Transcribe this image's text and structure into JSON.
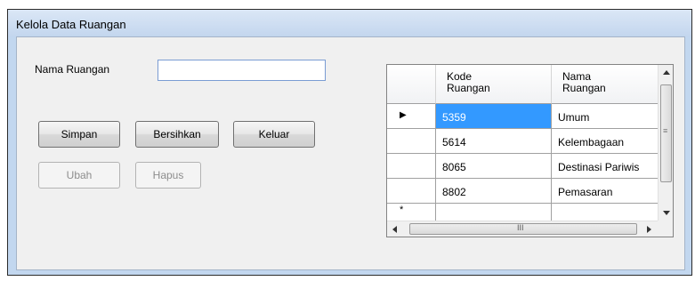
{
  "window": {
    "title": "Kelola Data Ruangan"
  },
  "form": {
    "nama_label": "Nama Ruangan",
    "nama_value": "",
    "nama_placeholder": ""
  },
  "buttons": {
    "simpan": "Simpan",
    "bersihkan": "Bersihkan",
    "keluar": "Keluar",
    "ubah": "Ubah",
    "hapus": "Hapus"
  },
  "grid": {
    "columns": [
      {
        "line1": "Kode",
        "line2": "Ruangan"
      },
      {
        "line1": "Nama",
        "line2": "Ruangan"
      }
    ],
    "rows": [
      {
        "kode": "5359",
        "nama": "Umum"
      },
      {
        "kode": "5614",
        "nama": "Kelembagaan"
      },
      {
        "kode": "8065",
        "nama": "Destinasi Pariwis"
      },
      {
        "kode": "8802",
        "nama": "Pemasaran"
      }
    ],
    "selected_row": 0,
    "current_row_glyph": "▶",
    "new_row_glyph": "*",
    "hscroll_grip": "III",
    "vscroll_grip": "≡"
  },
  "icons": {
    "up": "arrow-up-icon",
    "down": "arrow-down-icon",
    "left": "arrow-left-icon",
    "right": "arrow-right-icon"
  },
  "colors": {
    "selection": "#3399ff",
    "titlebar": "#c3d6ee",
    "client": "#f0f0f0"
  }
}
